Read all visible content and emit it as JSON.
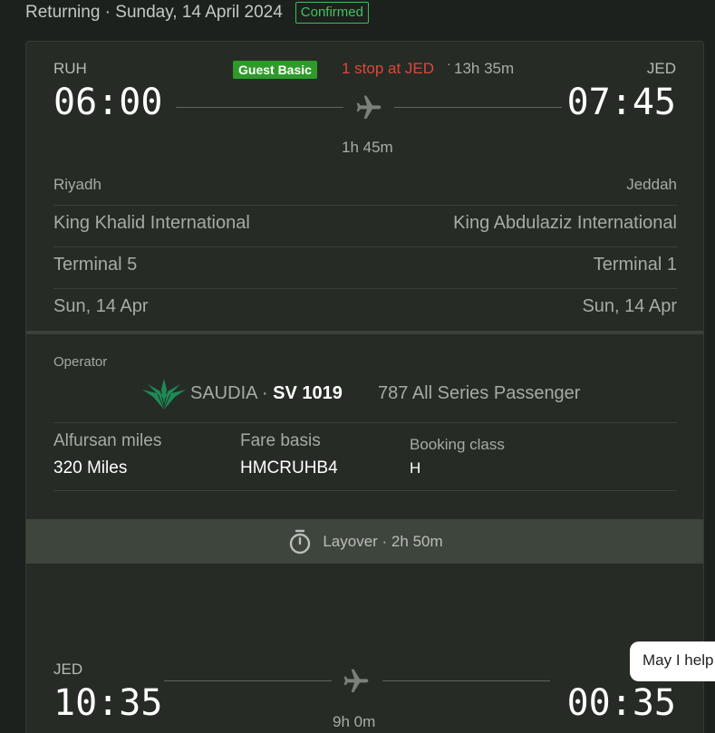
{
  "header": {
    "title": "Returning · Sunday, 14 April 2024",
    "status": "Confirmed"
  },
  "segment1": {
    "origin_code": "RUH",
    "dest_code": "JED",
    "fare_badge": "Guest Basic",
    "stops": "1 stop at JED",
    "total_duration": "13h 35m",
    "dep_time": "06:00",
    "arr_time": "07:45",
    "duration": "1h 45m",
    "origin_city": "Riyadh",
    "dest_city": "Jeddah",
    "origin_airport": "King Khalid International",
    "dest_airport": "King Abdulaziz International",
    "origin_terminal": "Terminal 5",
    "dest_terminal": "Terminal 1",
    "dep_date": "Sun, 14 Apr",
    "arr_date": "Sun, 14 Apr",
    "operator_label": "Operator",
    "airline": "SAUDIA",
    "flight_no": "SV 1019",
    "aircraft": "787 All Series Passenger",
    "miles_label": "Alfursan miles",
    "miles_value": "320 Miles",
    "fare_basis_label": "Fare basis",
    "fare_basis_value": "HMCRUHB4",
    "booking_class_label": "Booking class",
    "booking_class_value": "H"
  },
  "layover": {
    "text": "Layover · 2h 50m"
  },
  "segment2": {
    "origin_code": "JED",
    "dep_time": "10:35",
    "arr_time": "00:35",
    "duration": "9h 0m"
  },
  "chat": {
    "text": "May I help"
  },
  "colors": {
    "background": "#1d211d",
    "card": "#262b25",
    "confirmed": "#3fc35f",
    "badge": "#2e9a2a",
    "stops": "#e0463c",
    "saudia_green": "#1e8a57"
  },
  "icons": [
    "airplane-icon",
    "stopwatch-icon",
    "saudia-logo"
  ]
}
